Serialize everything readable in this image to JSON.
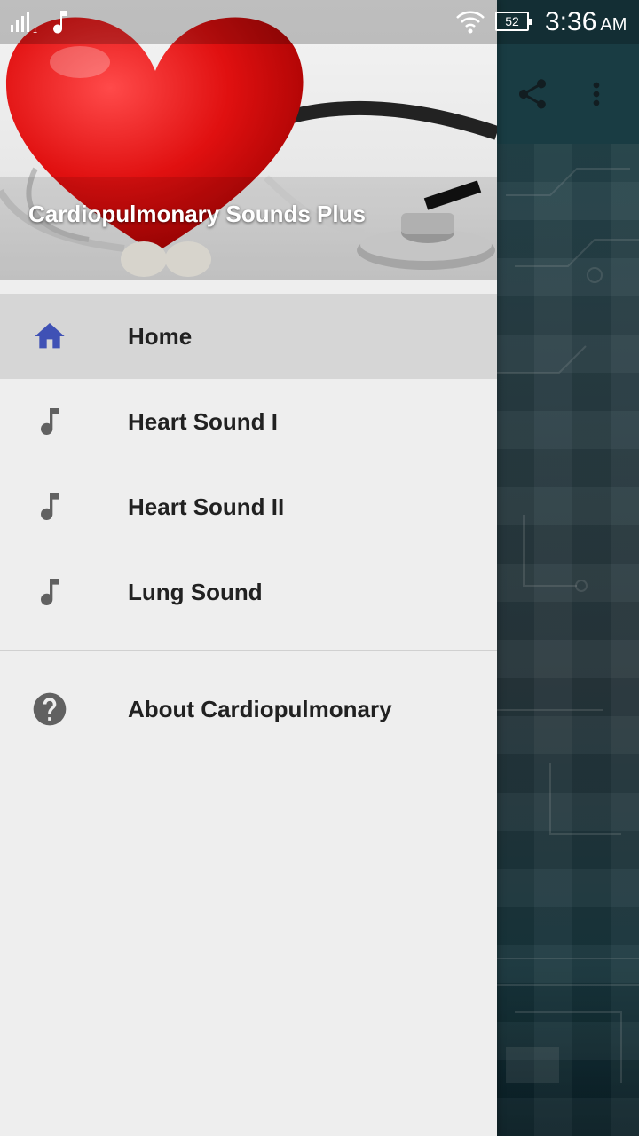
{
  "status_bar": {
    "sim_label": "1",
    "battery": "52",
    "time": "3:36",
    "ampm": "AM"
  },
  "drawer": {
    "header_title": "Cardiopulmonary Sounds Plus",
    "items": [
      {
        "label": "Home",
        "icon": "home-icon",
        "selected": true
      },
      {
        "label": "Heart Sound I",
        "icon": "music-note-icon",
        "selected": false
      },
      {
        "label": "Heart Sound II",
        "icon": "music-note-icon",
        "selected": false
      },
      {
        "label": "Lung Sound",
        "icon": "music-note-icon",
        "selected": false
      }
    ],
    "secondary_items": [
      {
        "label": "About Cardiopulmonary",
        "icon": "help-icon"
      }
    ]
  },
  "toolbar": {
    "actions": [
      "share-icon",
      "more-vert-icon"
    ]
  },
  "colors": {
    "drawer_bg": "#eeeeee",
    "selected_bg": "#d6d6d6",
    "home_icon": "#3f51b5",
    "item_icon": "#616161",
    "toolbar": "#245660"
  }
}
